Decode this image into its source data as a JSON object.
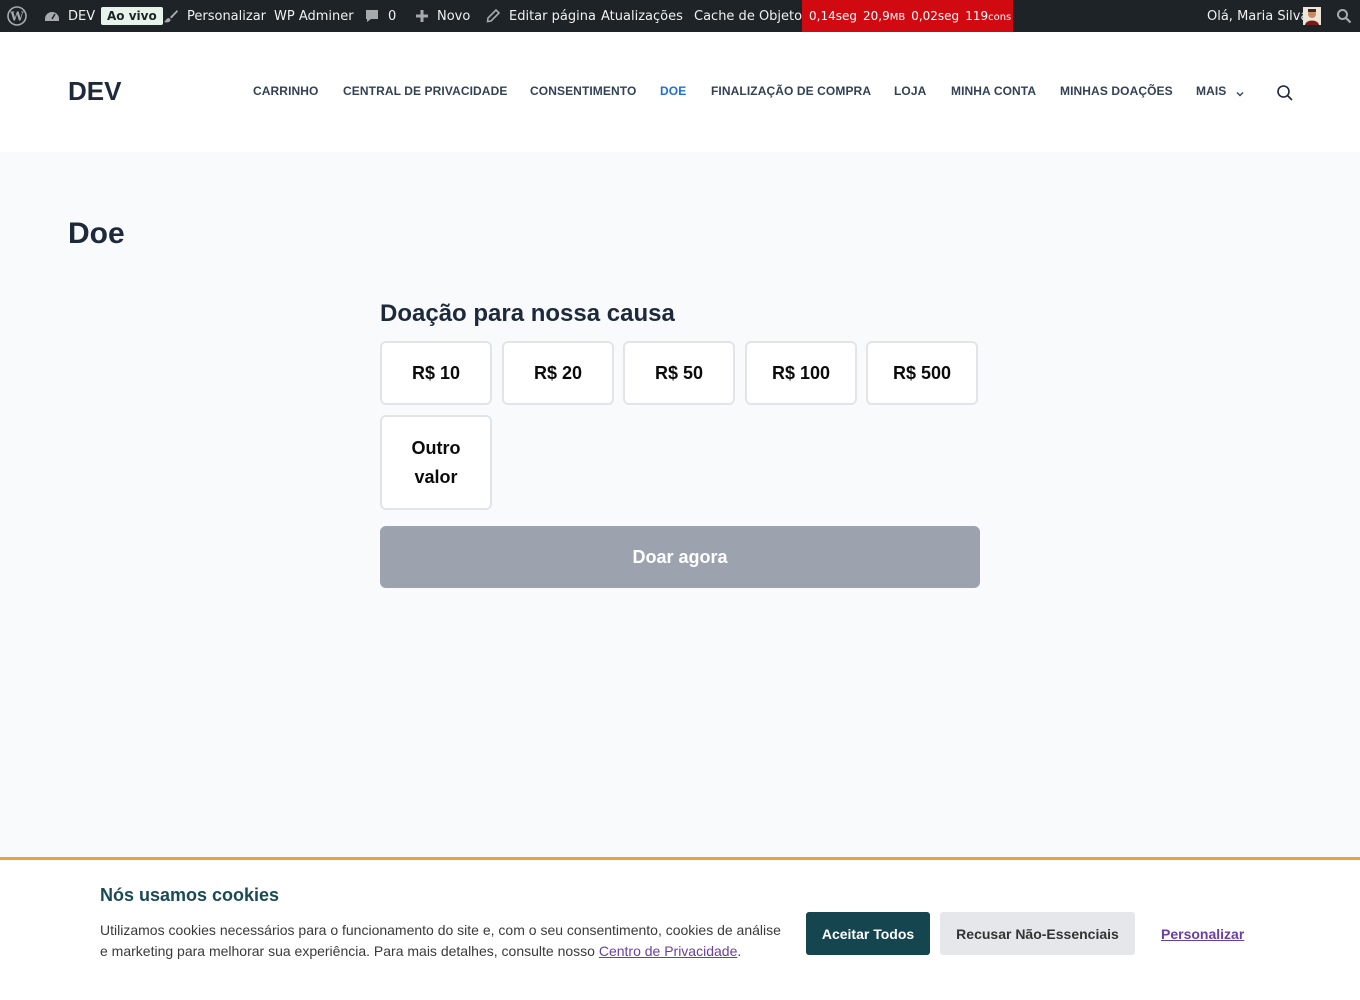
{
  "adminbar": {
    "wp_logo_icon": "wordpress-icon",
    "site_name": "DEV",
    "live_badge": "Ao vivo",
    "customize": "Personalizar",
    "wp_adminer": "WP Adminer",
    "comments_count": "0",
    "new": "Novo",
    "edit_page": "Editar página",
    "updates": "Atualizações",
    "object_cache": "Cache de Objeto",
    "perf": {
      "time1": "0,14seg",
      "memory_value": "20,9",
      "memory_unit": "MB",
      "time2": "0,02seg",
      "queries_value": "119",
      "queries_unit": "cons"
    },
    "greeting": "Olá, Maria Silva"
  },
  "header": {
    "logo": "DEV",
    "nav": [
      {
        "label": "CARRINHO"
      },
      {
        "label": "CENTRAL DE PRIVACIDADE"
      },
      {
        "label": "CONSENTIMENTO"
      },
      {
        "label": "DOE"
      },
      {
        "label": "FINALIZAÇÃO DE COMPRA"
      },
      {
        "label": "LOJA"
      },
      {
        "label": "MINHA CONTA"
      },
      {
        "label": "MINHAS DOAÇÕES"
      },
      {
        "label": "MAIS"
      }
    ],
    "active_color": "#1e6fd9"
  },
  "page": {
    "title": "Doe",
    "donation_title": "Doação para nossa causa",
    "amounts": [
      "R$ 10",
      "R$ 20",
      "R$ 50",
      "R$ 100",
      "R$ 500"
    ],
    "other_amount": "Outro valor",
    "donate_button": "Doar agora"
  },
  "cookie": {
    "title": "Nós usamos cookies",
    "text": "Utilizamos cookies necessários para o funcionamento do site e, com o seu consentimento, cookies de análise e marketing para melhorar sua experiência. Para mais detalhes, consulte nosso ",
    "link": "Centro de Privacidade",
    "text_end": ".",
    "accept": "Aceitar Todos",
    "reject": "Recusar Não-Essenciais",
    "customize": "Personalizar",
    "accent_color": "#15454f",
    "border_color": "#e8a33d"
  }
}
